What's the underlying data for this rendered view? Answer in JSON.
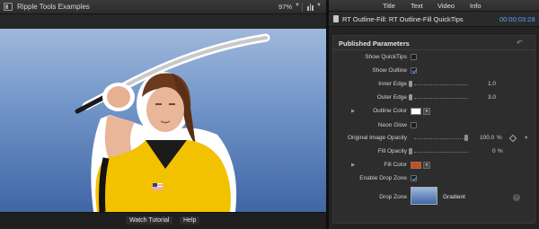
{
  "viewer": {
    "title": "Ripple Tools Examples",
    "zoom": "97%",
    "bottom_buttons": {
      "watch_tutorial": "Watch Tutorial",
      "help": "Help"
    }
  },
  "inspector": {
    "tabs": [
      "Title",
      "Text",
      "Video",
      "Info"
    ],
    "clip_name": "RT Outline-Fill: RT Outline-Fill QuickTips",
    "timecode": "00:00:03:28",
    "section_title": "Published Parameters",
    "params": {
      "show_quicktips": {
        "label": "Show QuickTips",
        "checked": false
      },
      "show_outline": {
        "label": "Show Outline",
        "checked": true
      },
      "inner_edge": {
        "label": "Inner Edge",
        "value": "1.0"
      },
      "outer_edge": {
        "label": "Outer Edge",
        "value": "3.0"
      },
      "outline_color": {
        "label": "Outline Color",
        "color": "#ffffff"
      },
      "neon_glow": {
        "label": "Neon Glow",
        "checked": false
      },
      "original_image_opacity": {
        "label": "Original Image Opacity",
        "value": "100.0",
        "unit": "%",
        "fraction": 1.0
      },
      "fill_opacity": {
        "label": "Fill Opacity",
        "value": "0",
        "unit": "%",
        "fraction": 0.0
      },
      "fill_color": {
        "label": "Fill Color",
        "color": "#d24a1a"
      },
      "enable_drop_zone": {
        "label": "Enable Drop Zone",
        "checked": true
      },
      "drop_zone": {
        "label": "Drop Zone",
        "content": "Gradient"
      }
    }
  },
  "colors": {
    "accent": "#5ea0ff",
    "canvas_top": "#9fb8db",
    "canvas_bottom": "#3f66a5",
    "uniform": "#f2c200"
  }
}
